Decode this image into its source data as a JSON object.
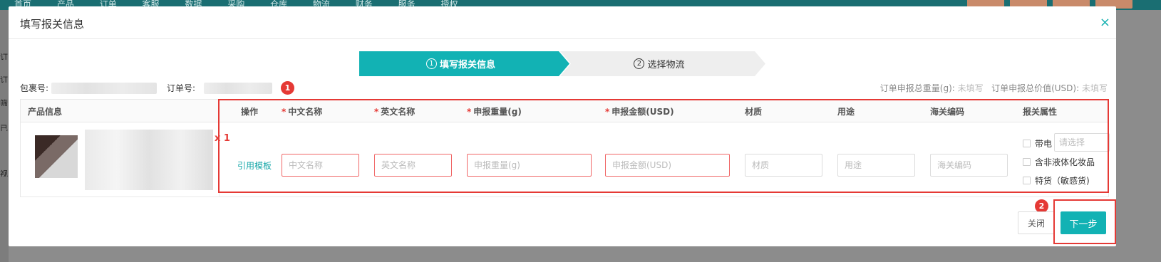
{
  "background": {
    "nav": [
      "首页",
      "产品",
      "订单",
      "客服",
      "数据",
      "采购",
      "仓库",
      "物流",
      "财务",
      "服务",
      "授权"
    ],
    "left_glyphs": [
      "订",
      "订",
      "筛",
      "已",
      "视"
    ]
  },
  "modal": {
    "title": "填写报关信息",
    "close_icon": "×"
  },
  "steps": [
    {
      "num": "1",
      "label": "填写报关信息",
      "active": true
    },
    {
      "num": "2",
      "label": "选择物流",
      "active": false
    }
  ],
  "info": {
    "package_label": "包裹号:",
    "order_label": "订单号:",
    "badge1": "1",
    "total_weight_label": "订单申报总重量(g):",
    "total_weight_value": "未填写",
    "total_value_label": "订单申报总价值(USD):",
    "total_value_value": "未填写"
  },
  "table": {
    "headers": {
      "product": "产品信息",
      "action": "操作",
      "cn_name": "中文名称",
      "en_name": "英文名称",
      "weight": "申报重量(g)",
      "amount": "申报金额(USD)",
      "material": "材质",
      "usage": "用途",
      "hs_code": "海关编码",
      "attr": "报关属性"
    },
    "required_mark": "*",
    "qty": "x 1",
    "template_link": "引用模板",
    "placeholders": {
      "cn_name": "中文名称",
      "en_name": "英文名称",
      "weight": "申报重量(g)",
      "amount": "申报金额(USD)",
      "material": "材质",
      "usage": "用途",
      "hs_code": "海关编码"
    },
    "attrs": {
      "battery": "带电",
      "select_placeholder": "请选择",
      "liquid": "含非液体化妆品",
      "sensitive": "特货（敏感货)"
    }
  },
  "footer": {
    "badge2": "2",
    "close_label": "关闭",
    "next_label": "下一步"
  },
  "colors": {
    "accent": "#12b2b4",
    "error": "#e53935"
  }
}
